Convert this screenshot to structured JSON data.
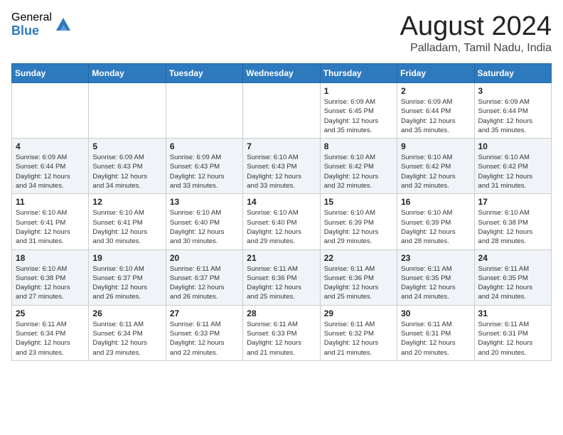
{
  "header": {
    "logo_general": "General",
    "logo_blue": "Blue",
    "month_title": "August 2024",
    "location": "Palladam, Tamil Nadu, India"
  },
  "calendar": {
    "days_of_week": [
      "Sunday",
      "Monday",
      "Tuesday",
      "Wednesday",
      "Thursday",
      "Friday",
      "Saturday"
    ],
    "weeks": [
      [
        {
          "day": "",
          "info": ""
        },
        {
          "day": "",
          "info": ""
        },
        {
          "day": "",
          "info": ""
        },
        {
          "day": "",
          "info": ""
        },
        {
          "day": "1",
          "info": "Sunrise: 6:09 AM\nSunset: 6:45 PM\nDaylight: 12 hours\nand 35 minutes."
        },
        {
          "day": "2",
          "info": "Sunrise: 6:09 AM\nSunset: 6:44 PM\nDaylight: 12 hours\nand 35 minutes."
        },
        {
          "day": "3",
          "info": "Sunrise: 6:09 AM\nSunset: 6:44 PM\nDaylight: 12 hours\nand 35 minutes."
        }
      ],
      [
        {
          "day": "4",
          "info": "Sunrise: 6:09 AM\nSunset: 6:44 PM\nDaylight: 12 hours\nand 34 minutes."
        },
        {
          "day": "5",
          "info": "Sunrise: 6:09 AM\nSunset: 6:43 PM\nDaylight: 12 hours\nand 34 minutes."
        },
        {
          "day": "6",
          "info": "Sunrise: 6:09 AM\nSunset: 6:43 PM\nDaylight: 12 hours\nand 33 minutes."
        },
        {
          "day": "7",
          "info": "Sunrise: 6:10 AM\nSunset: 6:43 PM\nDaylight: 12 hours\nand 33 minutes."
        },
        {
          "day": "8",
          "info": "Sunrise: 6:10 AM\nSunset: 6:42 PM\nDaylight: 12 hours\nand 32 minutes."
        },
        {
          "day": "9",
          "info": "Sunrise: 6:10 AM\nSunset: 6:42 PM\nDaylight: 12 hours\nand 32 minutes."
        },
        {
          "day": "10",
          "info": "Sunrise: 6:10 AM\nSunset: 6:42 PM\nDaylight: 12 hours\nand 31 minutes."
        }
      ],
      [
        {
          "day": "11",
          "info": "Sunrise: 6:10 AM\nSunset: 6:41 PM\nDaylight: 12 hours\nand 31 minutes."
        },
        {
          "day": "12",
          "info": "Sunrise: 6:10 AM\nSunset: 6:41 PM\nDaylight: 12 hours\nand 30 minutes."
        },
        {
          "day": "13",
          "info": "Sunrise: 6:10 AM\nSunset: 6:40 PM\nDaylight: 12 hours\nand 30 minutes."
        },
        {
          "day": "14",
          "info": "Sunrise: 6:10 AM\nSunset: 6:40 PM\nDaylight: 12 hours\nand 29 minutes."
        },
        {
          "day": "15",
          "info": "Sunrise: 6:10 AM\nSunset: 6:39 PM\nDaylight: 12 hours\nand 29 minutes."
        },
        {
          "day": "16",
          "info": "Sunrise: 6:10 AM\nSunset: 6:39 PM\nDaylight: 12 hours\nand 28 minutes."
        },
        {
          "day": "17",
          "info": "Sunrise: 6:10 AM\nSunset: 6:38 PM\nDaylight: 12 hours\nand 28 minutes."
        }
      ],
      [
        {
          "day": "18",
          "info": "Sunrise: 6:10 AM\nSunset: 6:38 PM\nDaylight: 12 hours\nand 27 minutes."
        },
        {
          "day": "19",
          "info": "Sunrise: 6:10 AM\nSunset: 6:37 PM\nDaylight: 12 hours\nand 26 minutes."
        },
        {
          "day": "20",
          "info": "Sunrise: 6:11 AM\nSunset: 6:37 PM\nDaylight: 12 hours\nand 26 minutes."
        },
        {
          "day": "21",
          "info": "Sunrise: 6:11 AM\nSunset: 6:36 PM\nDaylight: 12 hours\nand 25 minutes."
        },
        {
          "day": "22",
          "info": "Sunrise: 6:11 AM\nSunset: 6:36 PM\nDaylight: 12 hours\nand 25 minutes."
        },
        {
          "day": "23",
          "info": "Sunrise: 6:11 AM\nSunset: 6:35 PM\nDaylight: 12 hours\nand 24 minutes."
        },
        {
          "day": "24",
          "info": "Sunrise: 6:11 AM\nSunset: 6:35 PM\nDaylight: 12 hours\nand 24 minutes."
        }
      ],
      [
        {
          "day": "25",
          "info": "Sunrise: 6:11 AM\nSunset: 6:34 PM\nDaylight: 12 hours\nand 23 minutes."
        },
        {
          "day": "26",
          "info": "Sunrise: 6:11 AM\nSunset: 6:34 PM\nDaylight: 12 hours\nand 23 minutes."
        },
        {
          "day": "27",
          "info": "Sunrise: 6:11 AM\nSunset: 6:33 PM\nDaylight: 12 hours\nand 22 minutes."
        },
        {
          "day": "28",
          "info": "Sunrise: 6:11 AM\nSunset: 6:33 PM\nDaylight: 12 hours\nand 21 minutes."
        },
        {
          "day": "29",
          "info": "Sunrise: 6:11 AM\nSunset: 6:32 PM\nDaylight: 12 hours\nand 21 minutes."
        },
        {
          "day": "30",
          "info": "Sunrise: 6:11 AM\nSunset: 6:31 PM\nDaylight: 12 hours\nand 20 minutes."
        },
        {
          "day": "31",
          "info": "Sunrise: 6:11 AM\nSunset: 6:31 PM\nDaylight: 12 hours\nand 20 minutes."
        }
      ]
    ]
  }
}
